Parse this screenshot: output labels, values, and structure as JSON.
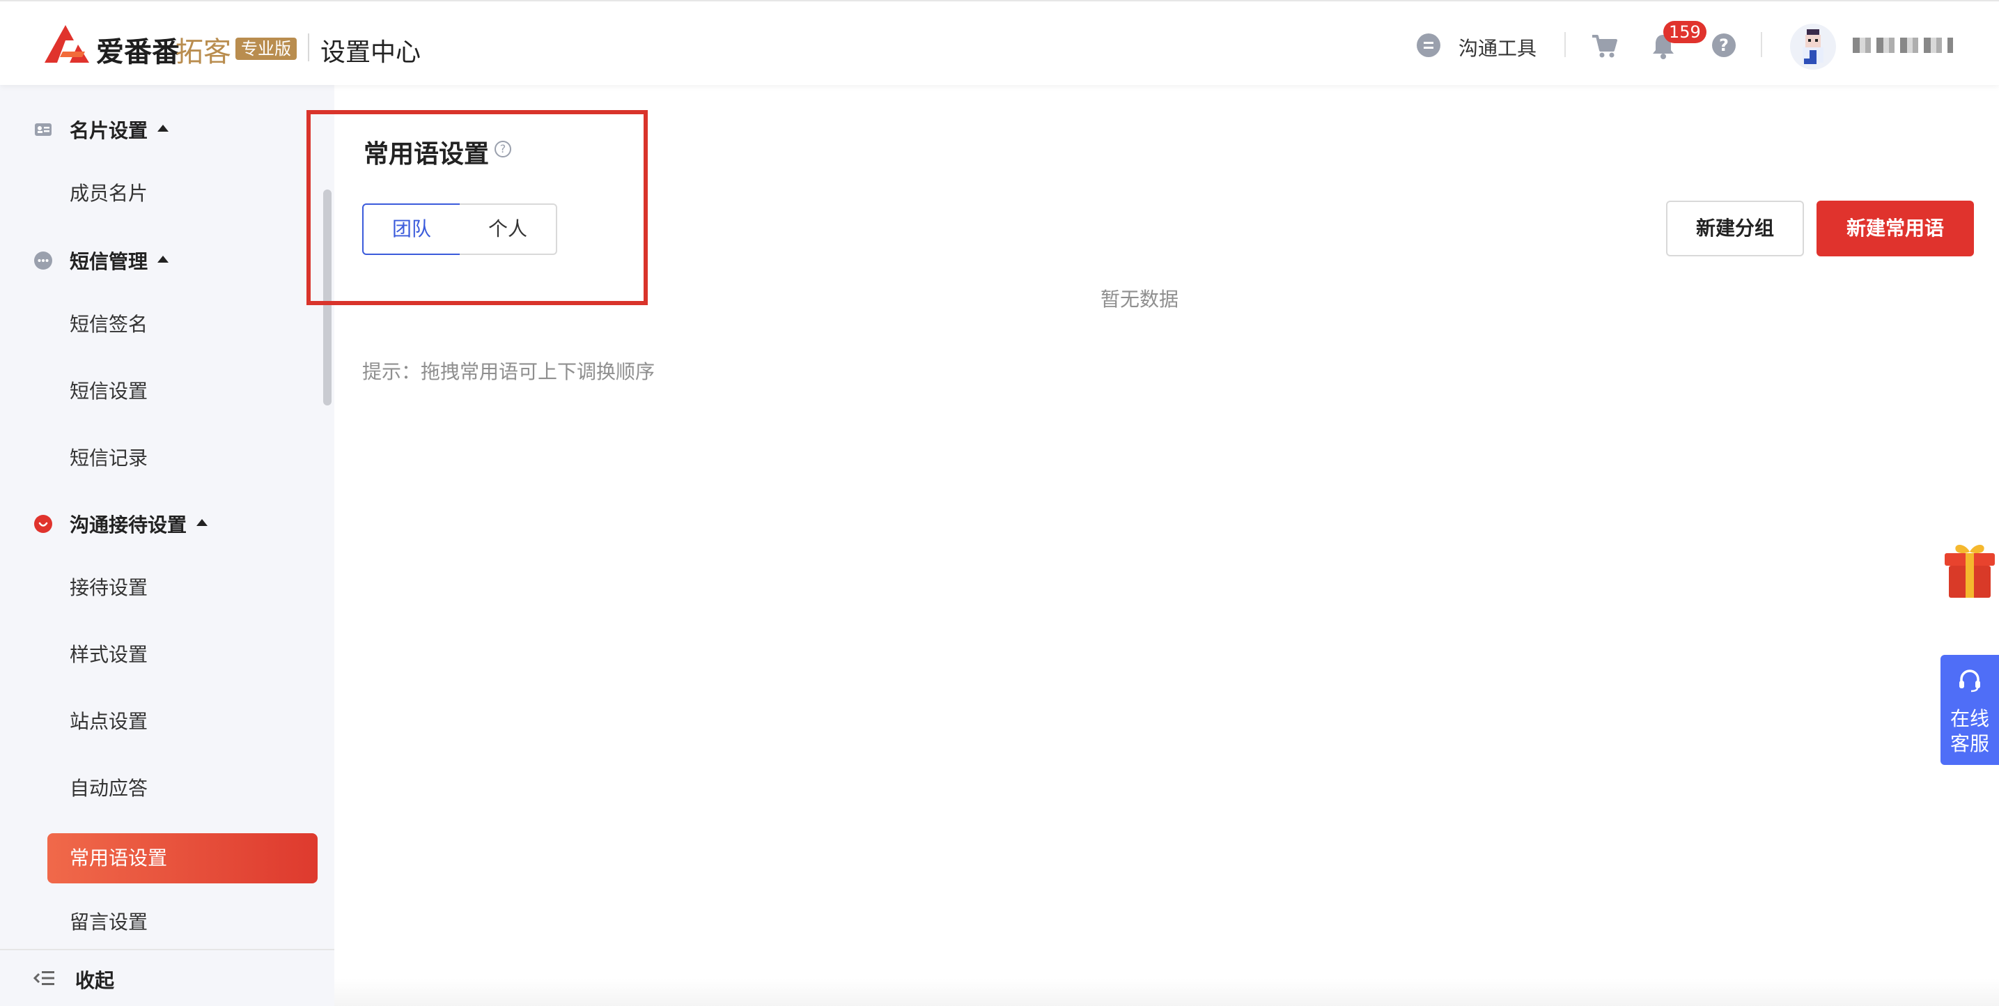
{
  "header": {
    "brand_name": "爱番番",
    "brand_sub": "拓客",
    "brand_badge": "专业版",
    "page_title": "设置中心",
    "tool_label": "沟通工具",
    "notification_count": "159"
  },
  "sidebar": {
    "groups": [
      {
        "label": "名片设置",
        "icon": "card-icon",
        "items": [
          "成员名片"
        ]
      },
      {
        "label": "短信管理",
        "icon": "chat-bubble-icon",
        "items": [
          "短信签名",
          "短信设置",
          "短信记录"
        ]
      },
      {
        "label": "沟通接待设置",
        "icon": "reception-icon",
        "items": [
          "接待设置",
          "样式设置",
          "站点设置",
          "自动应答",
          "常用语设置",
          "留言设置"
        ]
      }
    ],
    "active_item": "常用语设置",
    "collapse_label": "收起"
  },
  "main": {
    "title": "常用语设置",
    "tabs": [
      "团队",
      "个人"
    ],
    "selected_tab": "团队",
    "new_group_button": "新建分组",
    "new_phrase_button": "新建常用语",
    "empty_text": "暂无数据",
    "hint": "提示：拖拽常用语可上下调换顺序"
  },
  "widgets": {
    "support_label_line1": "在线",
    "support_label_line2": "客服"
  },
  "colors": {
    "accent_red": "#e0332d",
    "brand_gold": "#b98d4f",
    "selected_blue": "#3b5bdb",
    "support_blue": "#4f6ef7"
  }
}
